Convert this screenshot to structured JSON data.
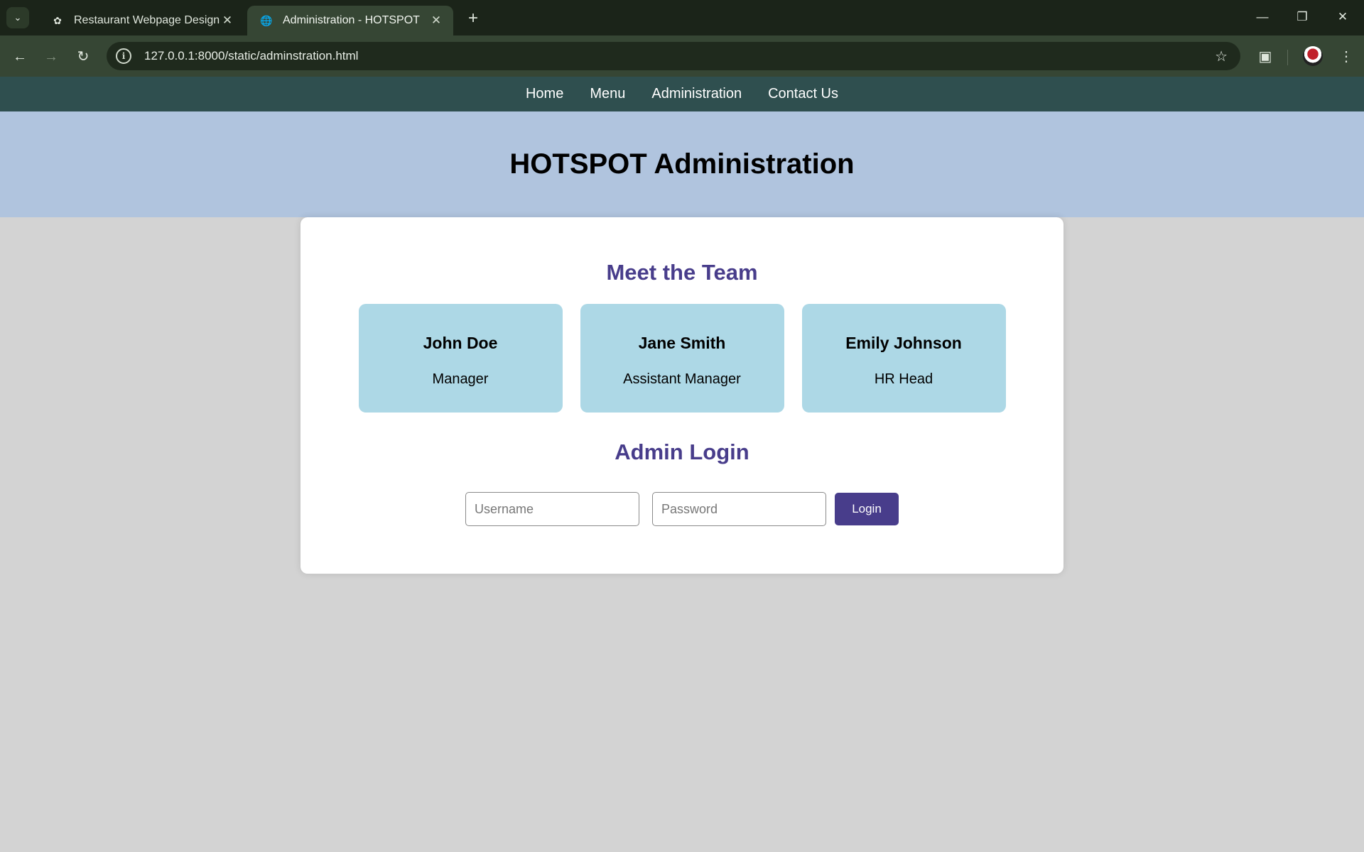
{
  "browser": {
    "tabs": [
      {
        "title": "Restaurant Webpage Design",
        "active": false,
        "favicon": "openai-icon"
      },
      {
        "title": "Administration - HOTSPOT",
        "active": true,
        "favicon": "globe-icon"
      }
    ],
    "url": "127.0.0.1:8000/static/adminstration.html"
  },
  "site_nav": {
    "items": [
      "Home",
      "Menu",
      "Administration",
      "Contact Us"
    ]
  },
  "hero": {
    "title": "HOTSPOT Administration"
  },
  "team": {
    "heading": "Meet the Team",
    "members": [
      {
        "name": "John Doe",
        "role": "Manager"
      },
      {
        "name": "Jane Smith",
        "role": "Assistant Manager"
      },
      {
        "name": "Emily Johnson",
        "role": "HR Head"
      }
    ]
  },
  "login": {
    "heading": "Admin Login",
    "username_placeholder": "Username",
    "password_placeholder": "Password",
    "button_label": "Login"
  },
  "colors": {
    "nav_bg": "#2f4f4f",
    "hero_bg": "#b0c4de",
    "page_bg": "#d3d3d3",
    "accent": "#483d8b",
    "card_bg": "#add8e6"
  }
}
